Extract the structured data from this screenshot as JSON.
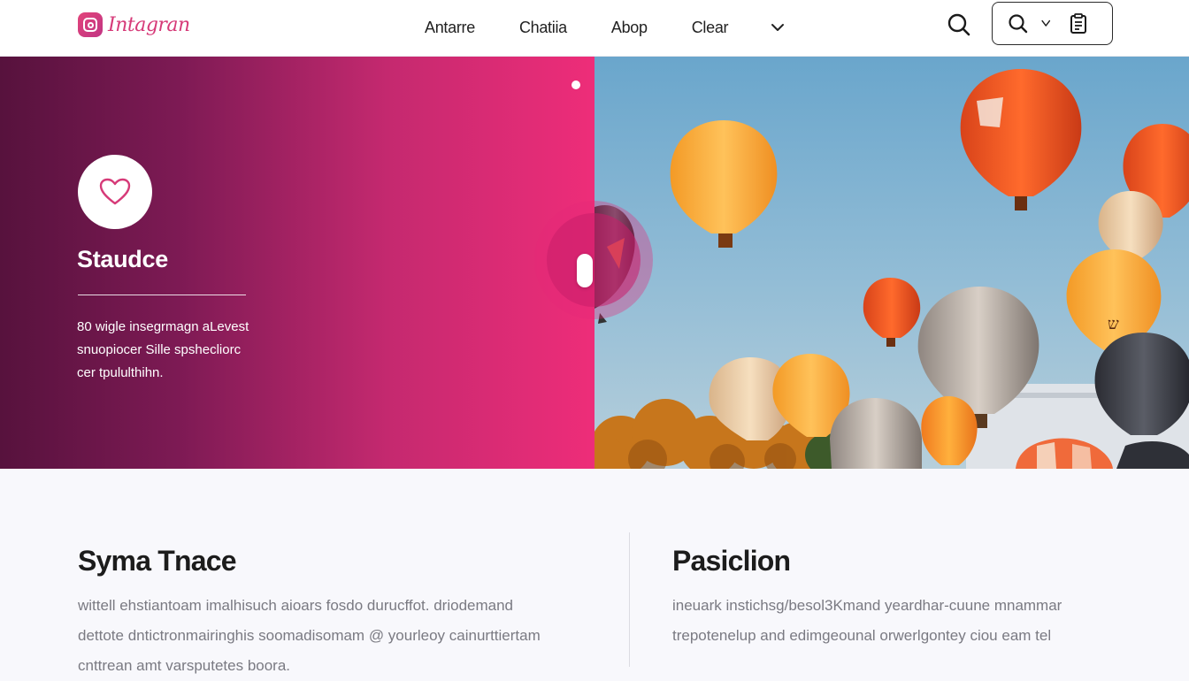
{
  "brand": {
    "name": "Intagran",
    "accent": "#d63a78"
  },
  "nav": {
    "items": [
      "Antarre",
      "Chatiia",
      "Abop",
      "Clear"
    ],
    "more_icon": "chevron-down-icon"
  },
  "toolbar": {
    "search_icon": "search-icon",
    "box_icons": [
      "search-icon",
      "chevron-down-icon",
      "clipboard-icon"
    ]
  },
  "hero": {
    "icon": "heart-icon",
    "title": "Staudce",
    "description_lines": [
      "80 wigle insegrmagn aLevest",
      "snuopiocer Sille spshecliorc",
      "cer tpululthihn."
    ],
    "gradient": [
      "#57123d",
      "#ee2d79"
    ],
    "image": "hot-air-balloons-photo"
  },
  "sections": [
    {
      "title": "Syma Tnace",
      "body_lines": [
        "wittell ehstiantoam imalhisuch aioars fosdo durucffot.  driodemand",
        "dettote dntictronmairinghis soomadisomam @ yourleoy cainurttiertam",
        "cnttrean amt varsputetes boora."
      ]
    },
    {
      "title": "Pasiclion",
      "body_lines": [
        "ineuark instichsg/besol3Kmand yeardhar-cuune mnammar",
        "trepotenelup and edimgeounal orwerlgontey ciou eam tel"
      ]
    }
  ]
}
